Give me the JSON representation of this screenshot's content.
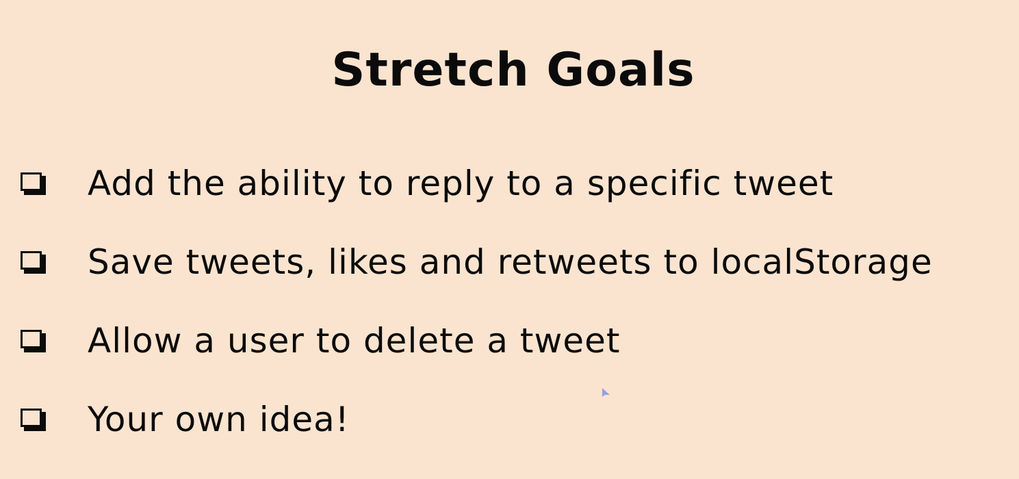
{
  "slide": {
    "title": "Stretch Goals",
    "background_color": "#fbe4cf",
    "text_color": "#0b0b0b",
    "goals": [
      {
        "icon": "checkbox-icon",
        "text": "Add the ability to reply to a specific tweet"
      },
      {
        "icon": "checkbox-icon",
        "text": "Save tweets, likes and retweets to localStorage"
      },
      {
        "icon": "checkbox-icon",
        "text": "Allow a user to delete a tweet"
      },
      {
        "icon": "checkbox-icon",
        "text": "Your own idea!"
      }
    ],
    "cursor": {
      "icon": "mouse-pointer-icon",
      "color": "#8fa3e6"
    }
  }
}
